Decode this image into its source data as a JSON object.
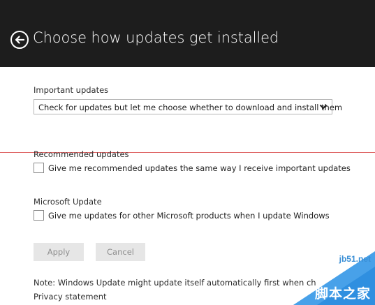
{
  "header": {
    "title": "Choose how updates get installed",
    "back_icon": "back-arrow-icon",
    "background": "#1d1d1d"
  },
  "important": {
    "label": "Important updates",
    "selected": "Check for updates but let me choose whether to download and install them"
  },
  "recommended": {
    "label": "Recommended updates",
    "checkbox_label": "Give me recommended updates the same way I receive important updates",
    "checked": false
  },
  "microsoft": {
    "label": "Microsoft Update",
    "checkbox_label": "Give me updates for other Microsoft products when I update Windows",
    "checked": false
  },
  "buttons": {
    "apply": "Apply",
    "cancel": "Cancel"
  },
  "note": "Note: Windows Update might update itself automatically first when ch",
  "privacy": "Privacy statement",
  "watermark": {
    "site": "jb51.net",
    "brand": "脚本之家"
  },
  "colors": {
    "accent_line": "#e06a6a",
    "watermark_blue": "#3a8fd6"
  }
}
